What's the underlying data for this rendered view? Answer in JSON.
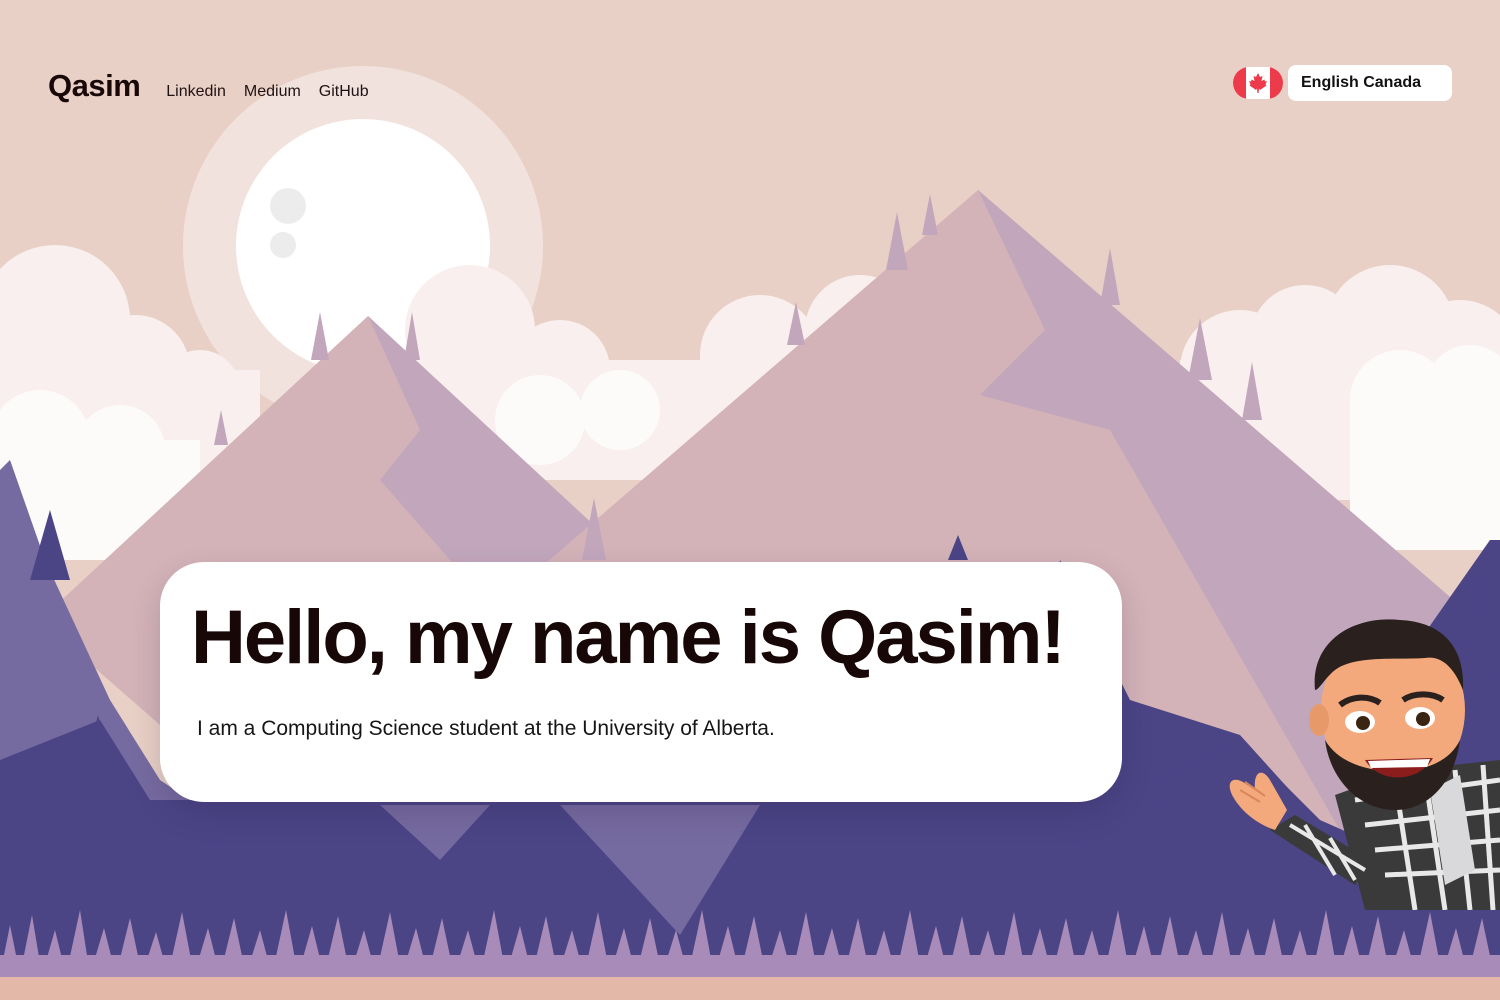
{
  "header": {
    "brand": "Qasim",
    "nav": [
      {
        "label": "Linkedin"
      },
      {
        "label": "Medium"
      },
      {
        "label": "GitHub"
      }
    ]
  },
  "language": {
    "flag_icon": "canada-flag-icon",
    "selected": "English Canada"
  },
  "hero": {
    "title": "Hello, my name is Qasim!",
    "subtitle": "I am a Computing Science student at the University of Alberta."
  },
  "colors": {
    "sky": "#e9d0c6",
    "mountain_light": "#d3b3b8",
    "mountain_shade": "#c2a7bc",
    "forest": "#4b4586",
    "grass": "#a88bb8",
    "text": "#170707"
  }
}
